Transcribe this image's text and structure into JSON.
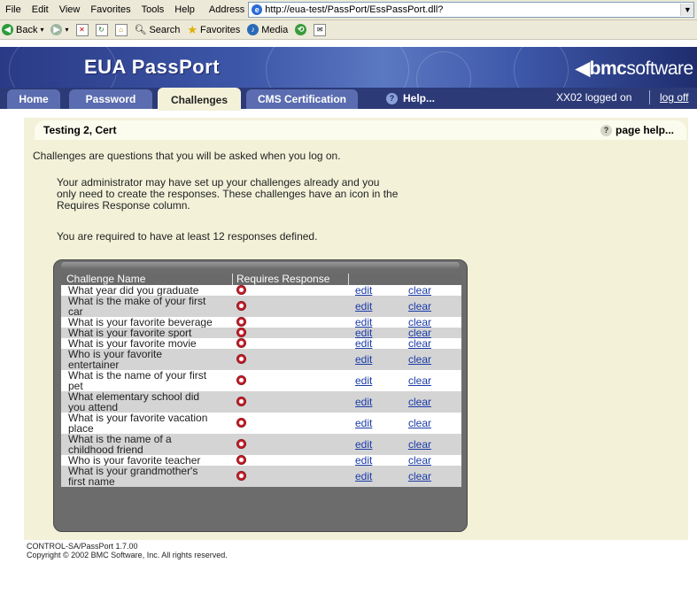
{
  "browser": {
    "menu": [
      "File",
      "Edit",
      "View",
      "Favorites",
      "Tools",
      "Help"
    ],
    "address_label": "Address",
    "url": "http://eua-test/PassPort/EssPassPort.dll?",
    "toolbar": {
      "back": "Back",
      "search": "Search",
      "favorites": "Favorites",
      "media": "Media"
    }
  },
  "banner": {
    "title": "EUA  PassPort",
    "brand_bmc": "bmc",
    "brand_software": "software"
  },
  "tabs": [
    {
      "label": "Home"
    },
    {
      "label": "Password"
    },
    {
      "label": "Challenges"
    },
    {
      "label": "CMS Certification"
    }
  ],
  "help_label": "Help...",
  "user_status": "XX02 logged on",
  "logoff_label": "log off",
  "page": {
    "user_name": "Testing 2, Cert",
    "page_help": "page help...",
    "intro": "Challenges are questions that you will be asked when you log on.",
    "note_line1": "Your administrator may have set up your challenges already and you",
    "note_line2": "only need to create the responses. These challenges have an icon in the",
    "note_line3": "Requires Response column.",
    "required": "You are required to have at least 12 responses defined."
  },
  "table": {
    "col_name": "Challenge Name",
    "col_requires": "Requires Response",
    "edit_label": "edit",
    "clear_label": "clear",
    "rows": [
      {
        "l1": "What year did you graduate",
        "l2": ""
      },
      {
        "l1": "What is the make of your first",
        "l2": "car"
      },
      {
        "l1": "What is your favorite beverage",
        "l2": ""
      },
      {
        "l1": "What is your favorite sport",
        "l2": ""
      },
      {
        "l1": "What is your favorite movie",
        "l2": ""
      },
      {
        "l1": "Who is your favorite",
        "l2": "entertainer"
      },
      {
        "l1": "What is the name of your first",
        "l2": "pet"
      },
      {
        "l1": "What elementary school did",
        "l2": "you attend"
      },
      {
        "l1": "What is your favorite vacation",
        "l2": "place"
      },
      {
        "l1": "What is the name of a",
        "l2": "childhood friend"
      },
      {
        "l1": "Who is your favorite teacher",
        "l2": ""
      },
      {
        "l1": "What is your grandmother's",
        "l2": "first name"
      }
    ]
  },
  "footer": {
    "line1": "CONTROL-SA/PassPort 1.7.00",
    "line2": "Copyright © 2002 BMC Software, Inc. All rights reserved."
  }
}
